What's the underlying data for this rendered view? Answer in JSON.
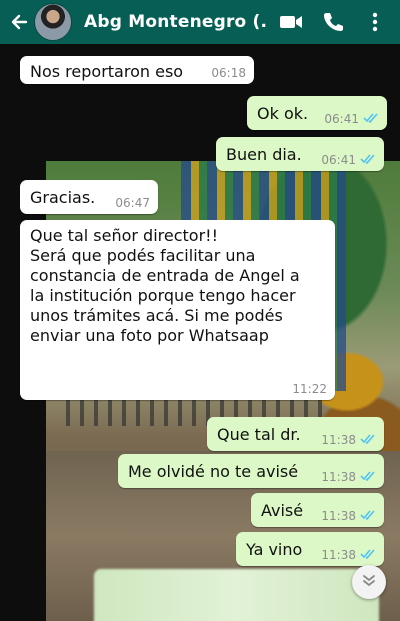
{
  "header": {
    "contact_name": "Abg Montenegro (...",
    "icons": [
      "back-arrow-icon",
      "video-call-icon",
      "phone-icon",
      "more-options-icon"
    ]
  },
  "colors": {
    "header_bg": "#075e54",
    "incoming_bubble": "#ffffff",
    "outgoing_bubble": "#dcf8c6",
    "read_ticks": "#4fc3f7"
  },
  "messages": [
    {
      "dir": "in",
      "text": "Nos reportaron eso",
      "time": "06:18"
    },
    {
      "dir": "out",
      "text": "Ok ok.",
      "time": "06:41",
      "status": "read"
    },
    {
      "dir": "out",
      "text": "Buen dia.",
      "time": "06:41",
      "status": "read"
    },
    {
      "dir": "in",
      "text": "Gracias.",
      "time": "06:47"
    },
    {
      "dir": "in",
      "text": "Que tal señor director!!\nSerá que podés facilitar una\nconstancia de entrada de Angel a\nla institución porque tengo hacer\nunos trámites acá. Si me podés\nenviar una foto por Whatsaap",
      "time": "11:22"
    },
    {
      "dir": "out",
      "text": "Que tal dr.",
      "time": "11:38",
      "status": "read"
    },
    {
      "dir": "out",
      "text": "Me olvidé no te avisé",
      "time": "11:38",
      "status": "read"
    },
    {
      "dir": "out",
      "text": "Avisé",
      "time": "11:38",
      "status": "read"
    },
    {
      "dir": "out",
      "text": "Ya vino",
      "time": "11:38",
      "status": "read"
    }
  ]
}
